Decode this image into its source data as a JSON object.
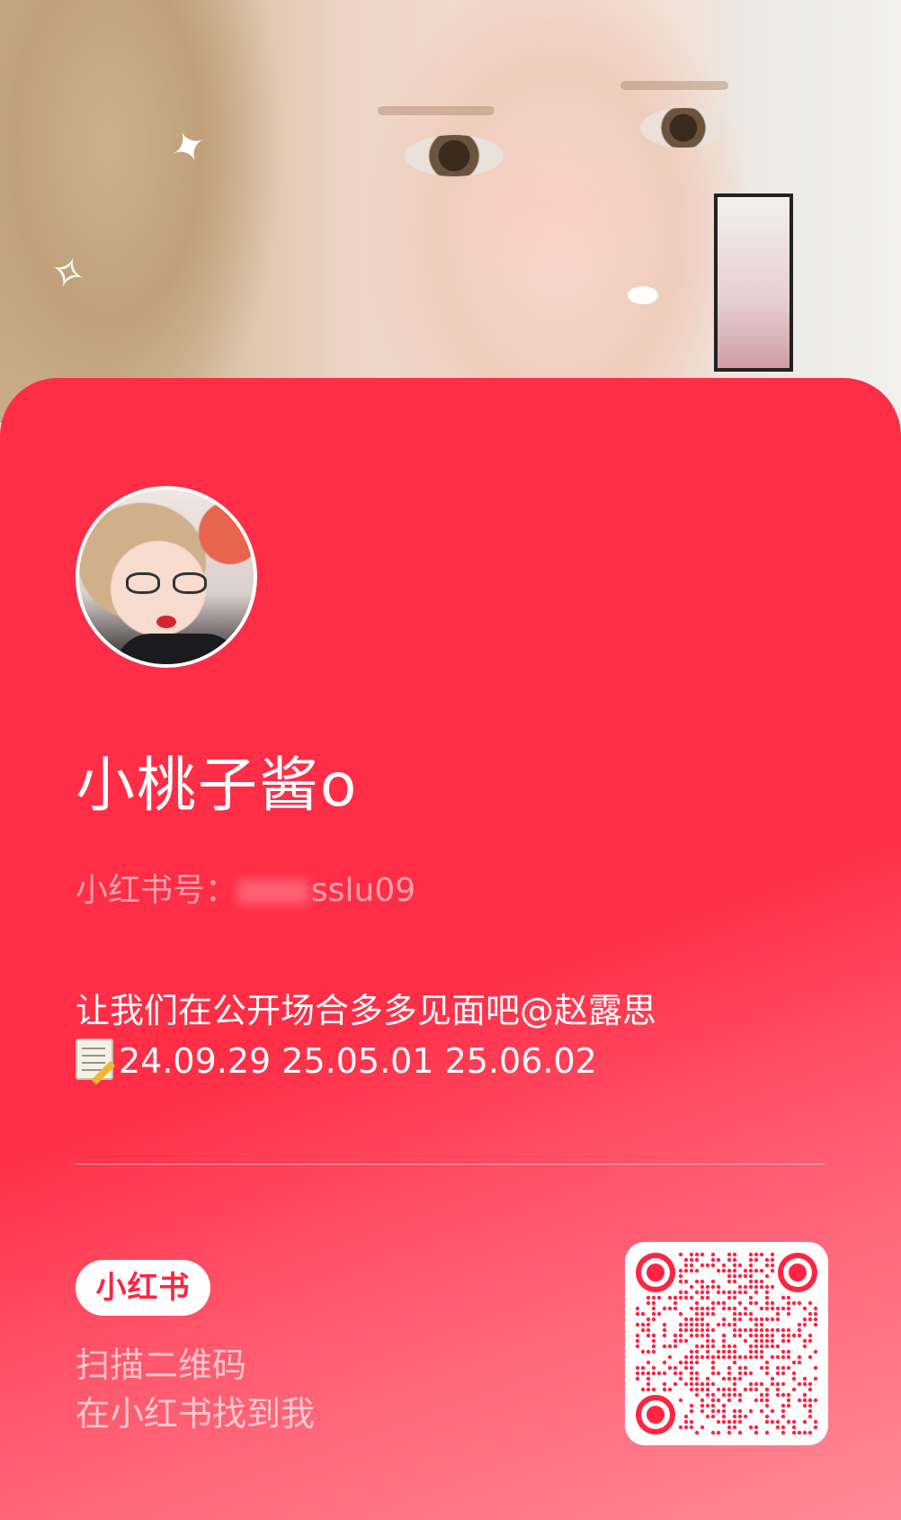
{
  "profile": {
    "name": "小桃子酱o",
    "id_label": "小红书号：",
    "id_value": "sslu09",
    "bio_line1": "让我们在公开场合多多见面吧@赵露思",
    "bio_dates": "24.09.29 25.05.01 25.06.02",
    "memo_icon": "memo-icon"
  },
  "footer": {
    "logo_text": "小红书",
    "scan_line1": "扫描二维码",
    "scan_line2": "在小红书找到我"
  },
  "colors": {
    "card_red": "#ff2d46",
    "qr_red": "#ff2442"
  }
}
